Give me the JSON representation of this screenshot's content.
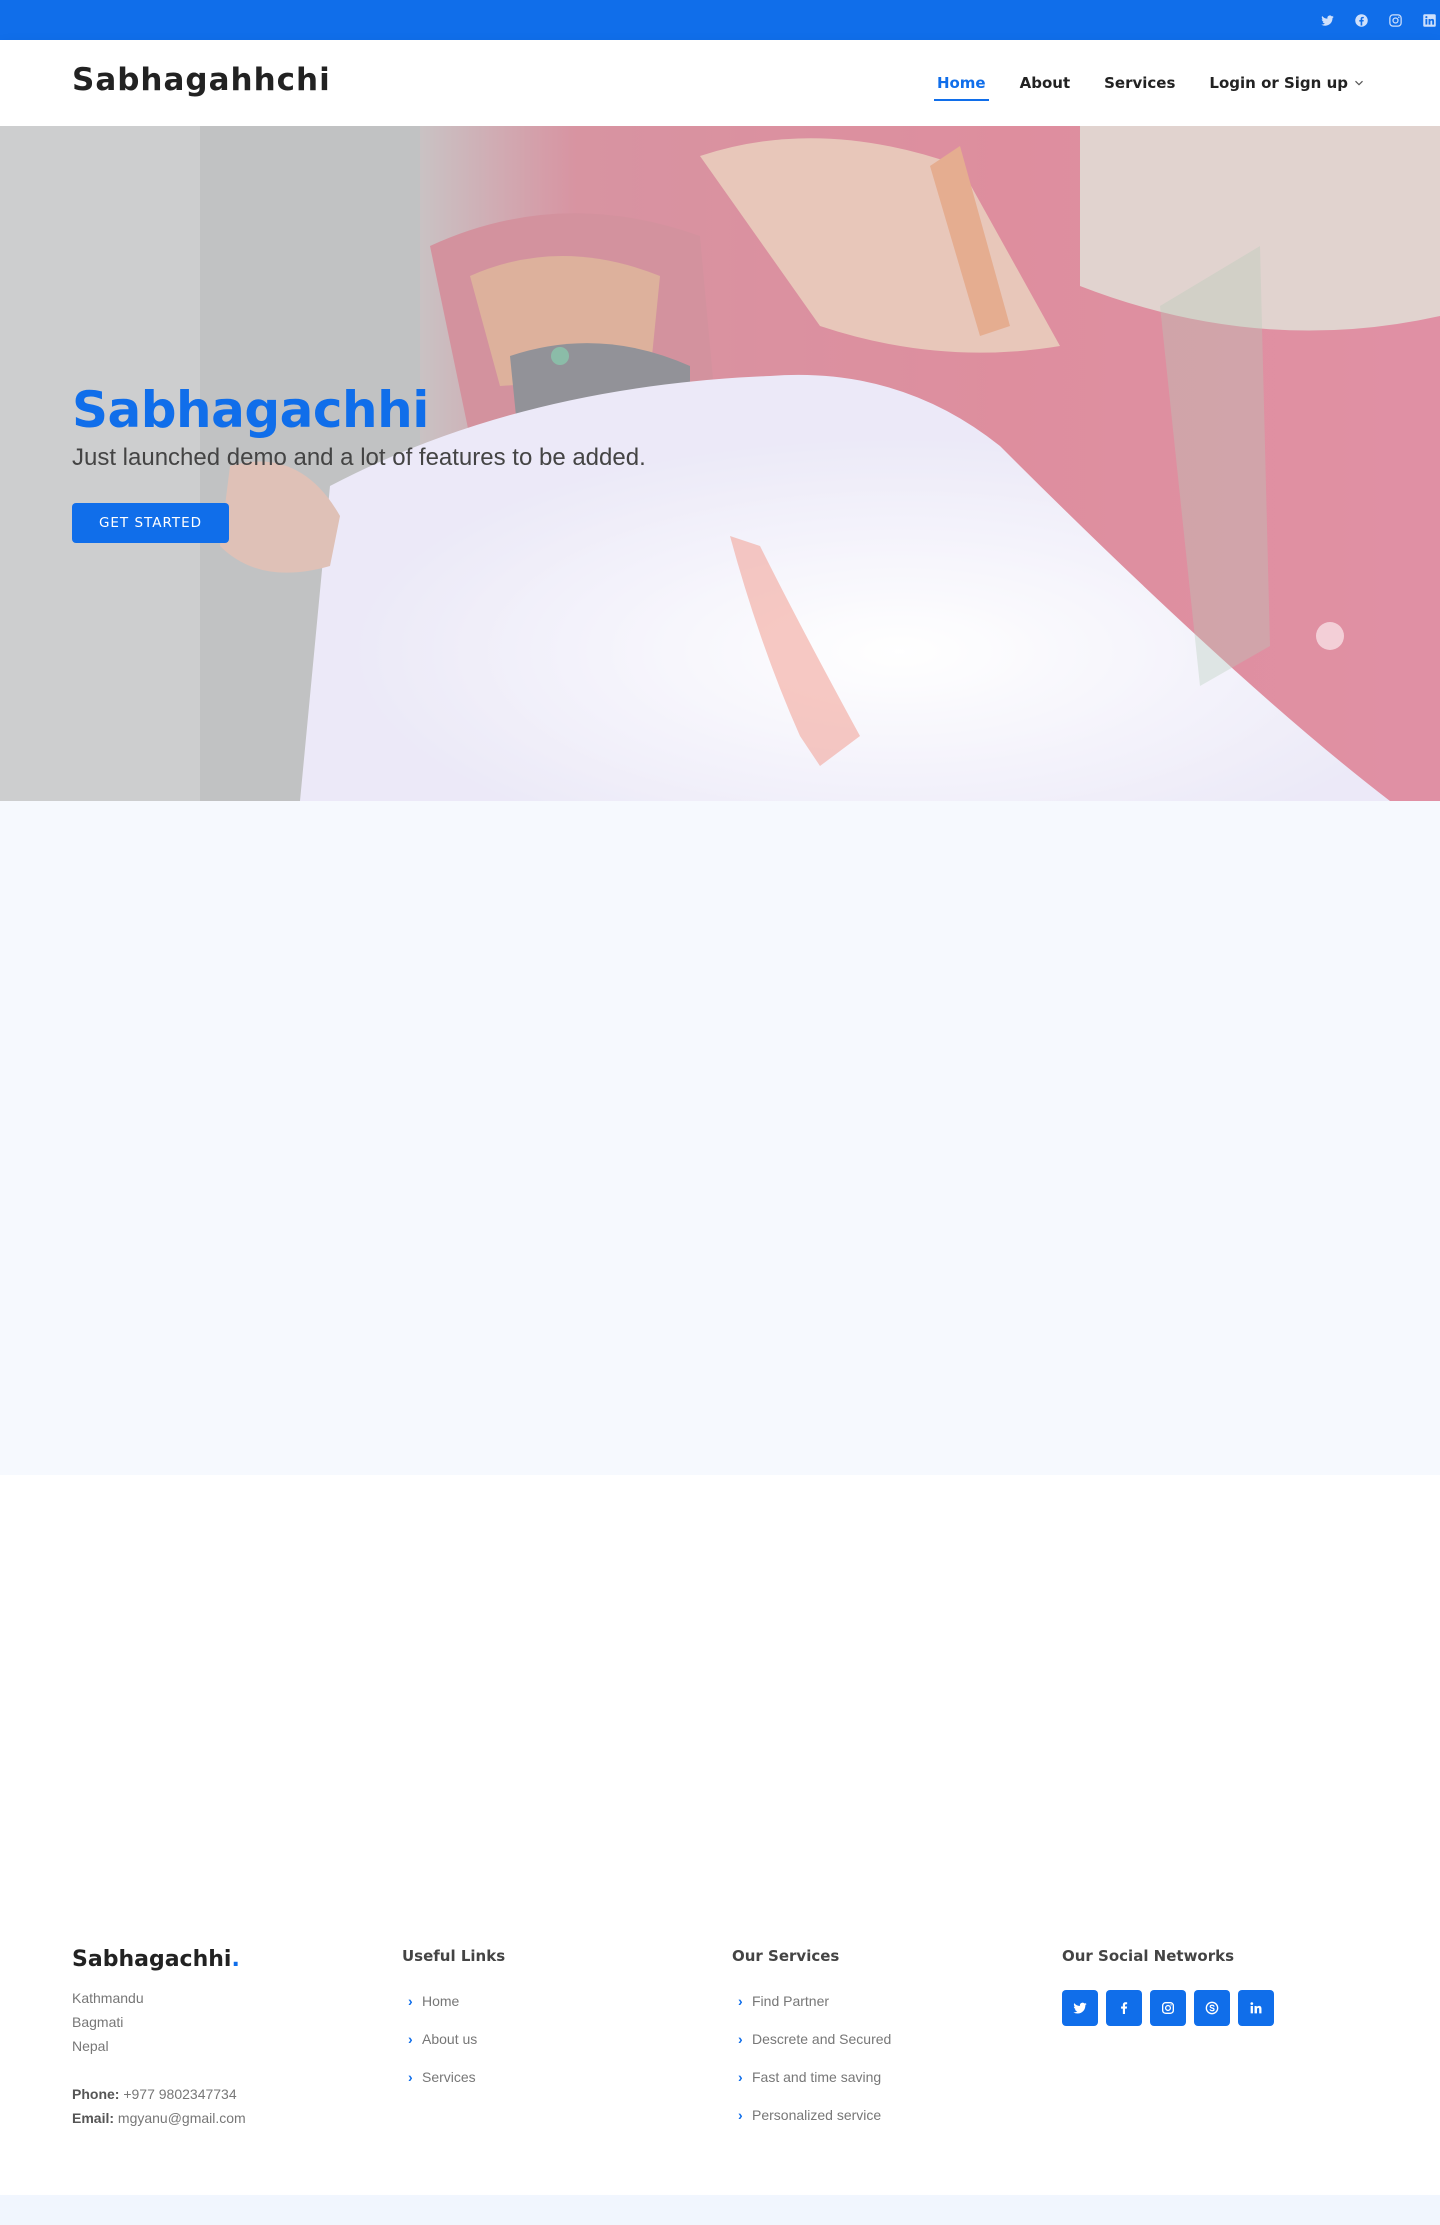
{
  "colors": {
    "primary": "#106eea",
    "section_bg": "#f6f9fe",
    "text_dark": "#222222",
    "text_muted": "#777777"
  },
  "topbar": {
    "social_icons": [
      "twitter-icon",
      "facebook-icon",
      "instagram-icon",
      "linkedin-icon"
    ]
  },
  "header": {
    "logo": "Sabhagahhchi",
    "nav": [
      {
        "label": "Home",
        "active": true
      },
      {
        "label": "About",
        "active": false
      },
      {
        "label": "Services",
        "active": false
      },
      {
        "label": "Login or Sign up",
        "active": false,
        "dropdown": true
      }
    ]
  },
  "hero": {
    "title": "Sabhagachhi",
    "subtitle": "Just launched demo and a lot of features to be added.",
    "cta": "GET STARTED"
  },
  "footer": {
    "brand": "Sabhagachhi",
    "brand_dot": ".",
    "address": [
      "Kathmandu",
      "Bagmati",
      "Nepal"
    ],
    "phone_label": "Phone:",
    "phone": "+977 9802347734",
    "email_label": "Email:",
    "email": "mgyanu@gmail.com",
    "useful_links": {
      "title": "Useful Links",
      "items": [
        "Home",
        "About us",
        "Services"
      ]
    },
    "services": {
      "title": "Our Services",
      "items": [
        "Find Partner",
        "Descrete and Secured",
        "Fast and time saving",
        "Personalized service"
      ]
    },
    "social": {
      "title": "Our Social Networks",
      "icons": [
        "twitter-icon",
        "facebook-icon",
        "instagram-icon",
        "skype-icon",
        "linkedin-icon"
      ]
    }
  }
}
